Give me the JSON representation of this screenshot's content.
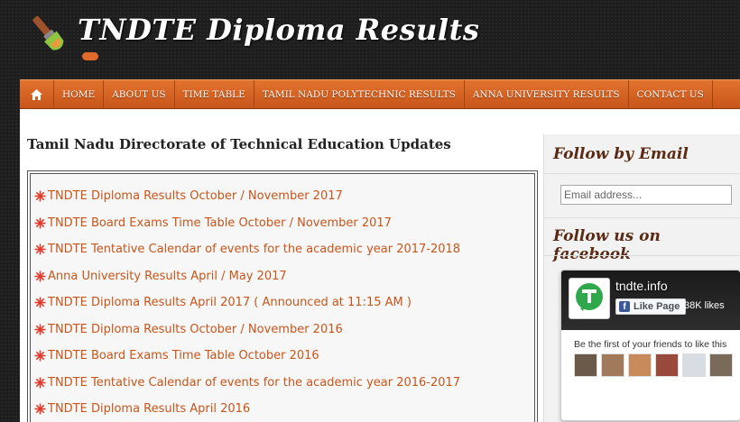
{
  "header": {
    "title": "TNDTE Diploma Results"
  },
  "nav": {
    "items": [
      {
        "label": "HOME"
      },
      {
        "label": "ABOUT US"
      },
      {
        "label": "TIME TABLE"
      },
      {
        "label": "TAMIL NADU POLYTECHNIC RESULTS"
      },
      {
        "label": "ANNA UNIVERSITY RESULTS"
      },
      {
        "label": "CONTACT US"
      }
    ],
    "home_icon": "home-icon"
  },
  "main": {
    "heading": "Tamil Nadu Directorate of Technical Education Updates",
    "updates": [
      {
        "label": "TNDTE Diploma Results October / November 2017"
      },
      {
        "label": "TNDTE Board Exams Time Table October / November 2017"
      },
      {
        "label": "TNDTE Tentative Calendar of events for the academic year 2017-2018"
      },
      {
        "label": "Anna University Results April / May 2017"
      },
      {
        "label": "TNDTE Diploma Results April 2017 ( Announced at 11:15 AM )"
      },
      {
        "label": "TNDTE Diploma Results October / November 2016"
      },
      {
        "label": "TNDTE Board Exams Time Table October 2016"
      },
      {
        "label": "TNDTE Tentative Calendar of events for the academic year 2016-2017"
      },
      {
        "label": "TNDTE Diploma Results April 2016"
      }
    ]
  },
  "sidebar": {
    "follow_email_title": "Follow by Email",
    "email_placeholder": "Email address...",
    "follow_facebook_title": "Follow us on facebook",
    "facebook": {
      "page_name": "tndte.info",
      "like_button": "Like Page",
      "likes_count": "38K likes",
      "friends_text": "Be the first of your friends to like this"
    }
  },
  "colors": {
    "accent": "#c8551a",
    "nav_bg": "#e2742f",
    "header_bg": "#1e1e1e",
    "sidebar_title": "#5a2a14"
  }
}
